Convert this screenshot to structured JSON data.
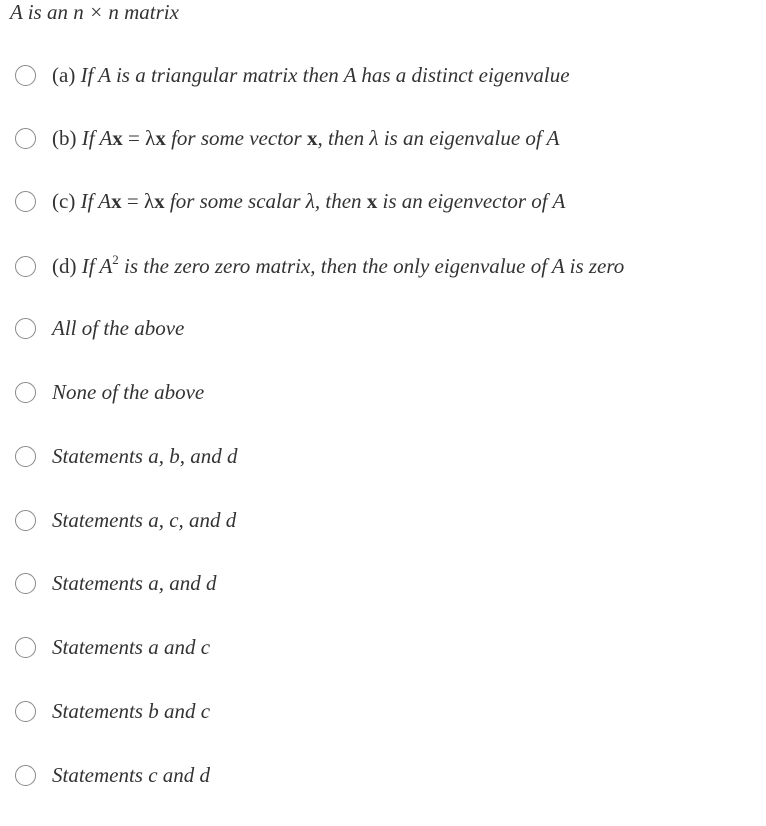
{
  "question": {
    "text": "A is an n × n matrix"
  },
  "options": [
    {
      "id": "a",
      "prefix": "(a)",
      "parts": [
        "If A is a triangular matrix then A has a distinct eigenvalue"
      ],
      "selected": false
    },
    {
      "id": "b",
      "prefix": "(b)",
      "if": "If A",
      "x1": "x",
      "eq": " = ",
      "lambda": "λ",
      "x2": "x",
      "mid": " for some vector ",
      "x3": "x",
      "tail": ",  then λ is an eigenvalue of A",
      "selected": false
    },
    {
      "id": "c",
      "prefix": "(c)",
      "if": "If A",
      "x1": "x",
      "eq": " = ",
      "lambda": "λ",
      "x2": "x",
      "mid": " for some scalar λ,  then ",
      "x3": "x",
      "tail": " is an eigenvector of A",
      "selected": false
    },
    {
      "id": "d",
      "prefix": "(d)",
      "if": "If A",
      "sup": "2",
      "tail": " is the zero zero matrix,  then the only eigenvalue of A is zero",
      "selected": false
    },
    {
      "id": "all",
      "text": "All of the above",
      "selected": false
    },
    {
      "id": "none",
      "text": "None of the above",
      "selected": false
    },
    {
      "id": "abd",
      "text": "Statements a,  b,  and d",
      "selected": false
    },
    {
      "id": "acd",
      "text": "Statements a,  c,  and d",
      "selected": false
    },
    {
      "id": "ad",
      "text": "Statements a,  and d",
      "selected": false
    },
    {
      "id": "ac",
      "text": "Statements a and c",
      "selected": false
    },
    {
      "id": "bc",
      "text": "Statements  b and c",
      "selected": false
    },
    {
      "id": "cd",
      "text": "Statements c and d",
      "selected": false
    }
  ],
  "colors": {
    "text": "#333333",
    "radio_border": "#8a8a8a",
    "background": "#ffffff"
  }
}
